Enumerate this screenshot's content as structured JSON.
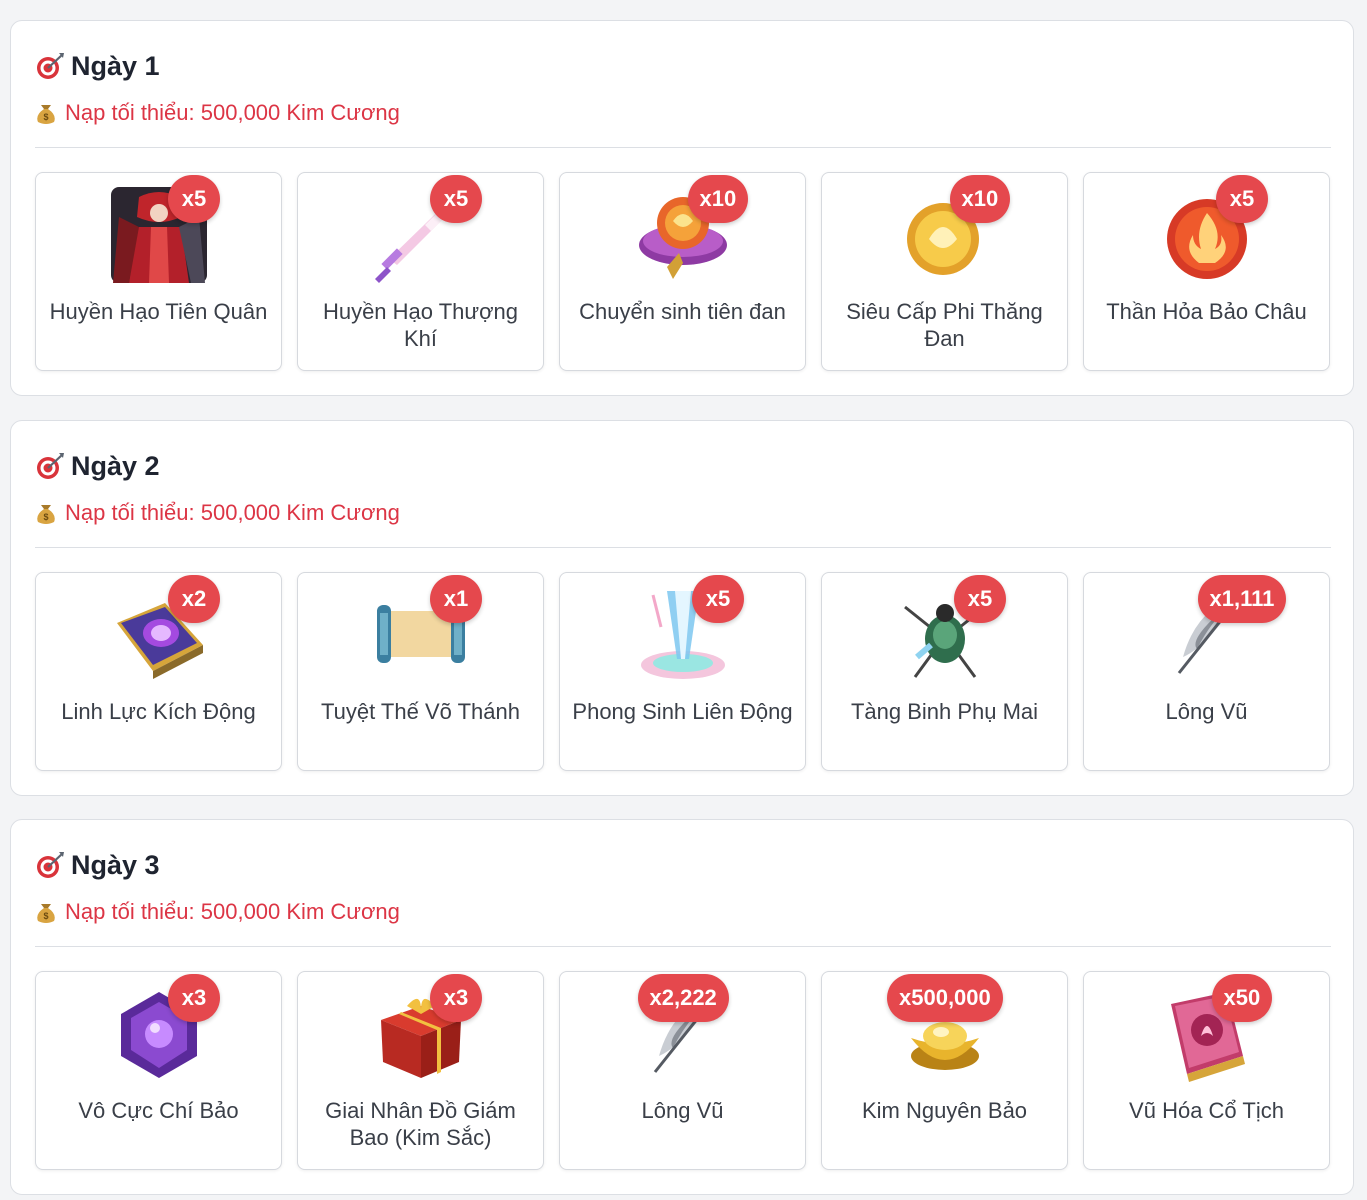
{
  "days": [
    {
      "title": "Ngày 1",
      "min_label": "Nạp tối thiểu: 500,000 Kim Cương",
      "items": [
        {
          "name": "Huyền Hạo Tiên Quân",
          "qty": "x5",
          "icon": "character-icon"
        },
        {
          "name": "Huyền Hạo Thượng Khí",
          "qty": "x5",
          "icon": "sword-icon"
        },
        {
          "name": "Chuyển sinh tiên đan",
          "qty": "x10",
          "icon": "elixir-icon"
        },
        {
          "name": "Siêu Cấp Phi Thăng Đan",
          "qty": "x10",
          "icon": "golden-pill-icon"
        },
        {
          "name": "Thần Hỏa Bảo Châu",
          "qty": "x5",
          "icon": "fire-orb-icon"
        }
      ]
    },
    {
      "title": "Ngày 2",
      "min_label": "Nạp tối thiểu: 500,000 Kim Cương",
      "items": [
        {
          "name": "Linh Lực Kích Động",
          "qty": "x2",
          "icon": "purple-book-icon"
        },
        {
          "name": "Tuyệt Thế Võ Thánh",
          "qty": "x1",
          "icon": "scroll-icon"
        },
        {
          "name": "Phong Sinh Liên Động",
          "qty": "x5",
          "icon": "portal-icon"
        },
        {
          "name": "Tàng Binh Phụ Mai",
          "qty": "x5",
          "icon": "beetle-icon"
        },
        {
          "name": "Lông Vũ",
          "qty": "x1,111",
          "icon": "feather-icon"
        }
      ]
    },
    {
      "title": "Ngày 3",
      "min_label": "Nạp tối thiểu: 500,000 Kim Cương",
      "items": [
        {
          "name": "Vô Cực Chí Bảo",
          "qty": "x3",
          "icon": "purple-gem-icon"
        },
        {
          "name": "Giai Nhân Đồ Giám Bao (Kim Sắc)",
          "qty": "x3",
          "icon": "gift-box-icon"
        },
        {
          "name": "Lông Vũ",
          "qty": "x2,222",
          "icon": "feather-icon"
        },
        {
          "name": "Kim Nguyên Bảo",
          "qty": "x500,000",
          "icon": "gold-ingot-icon"
        },
        {
          "name": "Vũ Hóa Cổ Tịch",
          "qty": "x50",
          "icon": "pink-book-icon"
        }
      ]
    }
  ]
}
